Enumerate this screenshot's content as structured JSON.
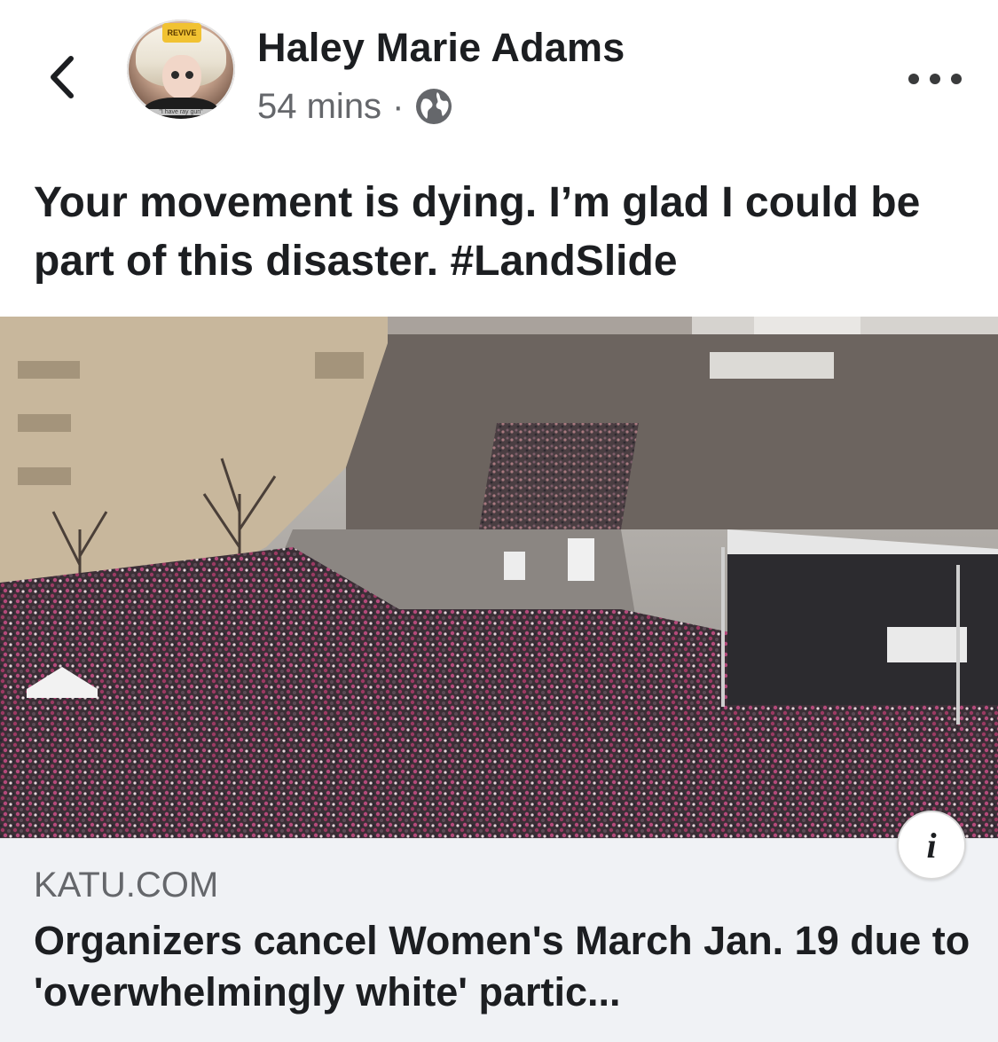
{
  "header": {
    "back_icon": "chevron-left-icon",
    "author_name": "Haley Marie Adams",
    "timestamp": "54 mins",
    "separator": "·",
    "privacy_icon": "globe-icon",
    "more_icon": "ellipsis-horizontal-icon",
    "avatar": {
      "badge_text": "REVIVE",
      "caption": "\"I have ray gun\""
    }
  },
  "post": {
    "text": "Your movement is dying. I’m glad I could be part of this disaster. #LandSlide"
  },
  "photo": {
    "description_icon": "crowd-photo"
  },
  "link_preview": {
    "info_icon": "i",
    "domain": "KATU.COM",
    "title": "Organizers cancel Women's March Jan. 19 due to 'overwhelmingly white' partic..."
  },
  "colors": {
    "text_primary": "#1c1e21",
    "text_secondary": "#65676b",
    "card_background": "#f0f2f5"
  }
}
